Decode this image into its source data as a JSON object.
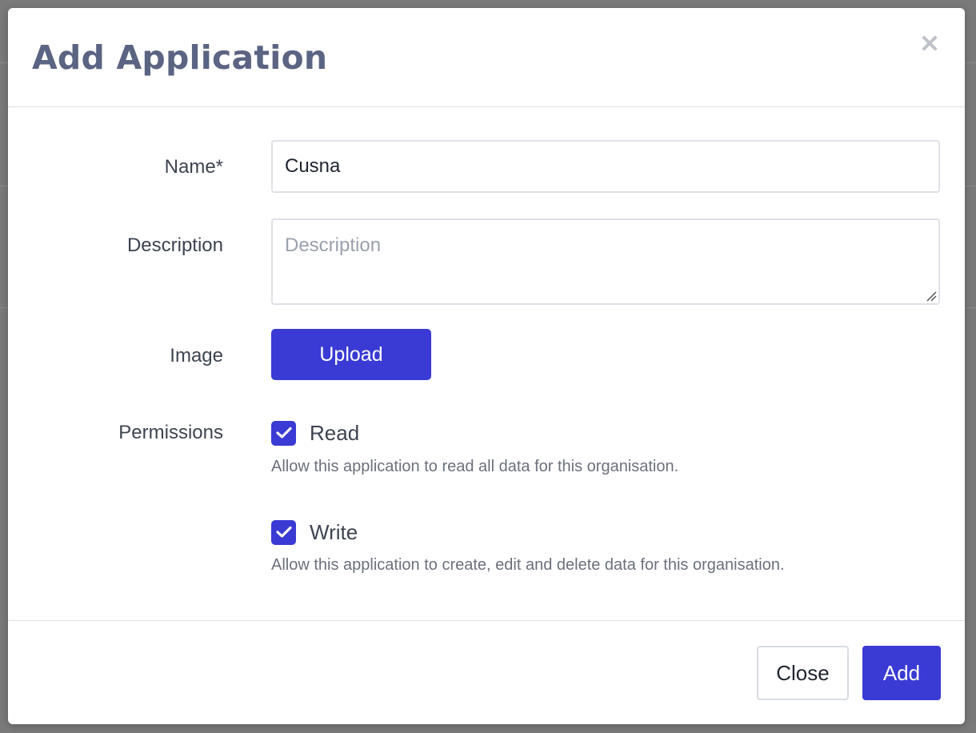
{
  "modal": {
    "title": "Add Application",
    "close_icon": "close-icon"
  },
  "form": {
    "name": {
      "label": "Name*",
      "value": "Cusna"
    },
    "description": {
      "label": "Description",
      "value": "",
      "placeholder": "Description"
    },
    "image": {
      "label": "Image",
      "upload_label": "Upload"
    },
    "permissions": {
      "label": "Permissions",
      "items": [
        {
          "label": "Read",
          "checked": true,
          "help": "Allow this application to read all data for this organisation."
        },
        {
          "label": "Write",
          "checked": true,
          "help": "Allow this application to create, edit and delete data for this organisation."
        }
      ]
    }
  },
  "footer": {
    "close_label": "Close",
    "add_label": "Add"
  },
  "colors": {
    "primary": "#3a3ad4",
    "title": "#5b6482",
    "overlay": "#7a7a7a"
  }
}
